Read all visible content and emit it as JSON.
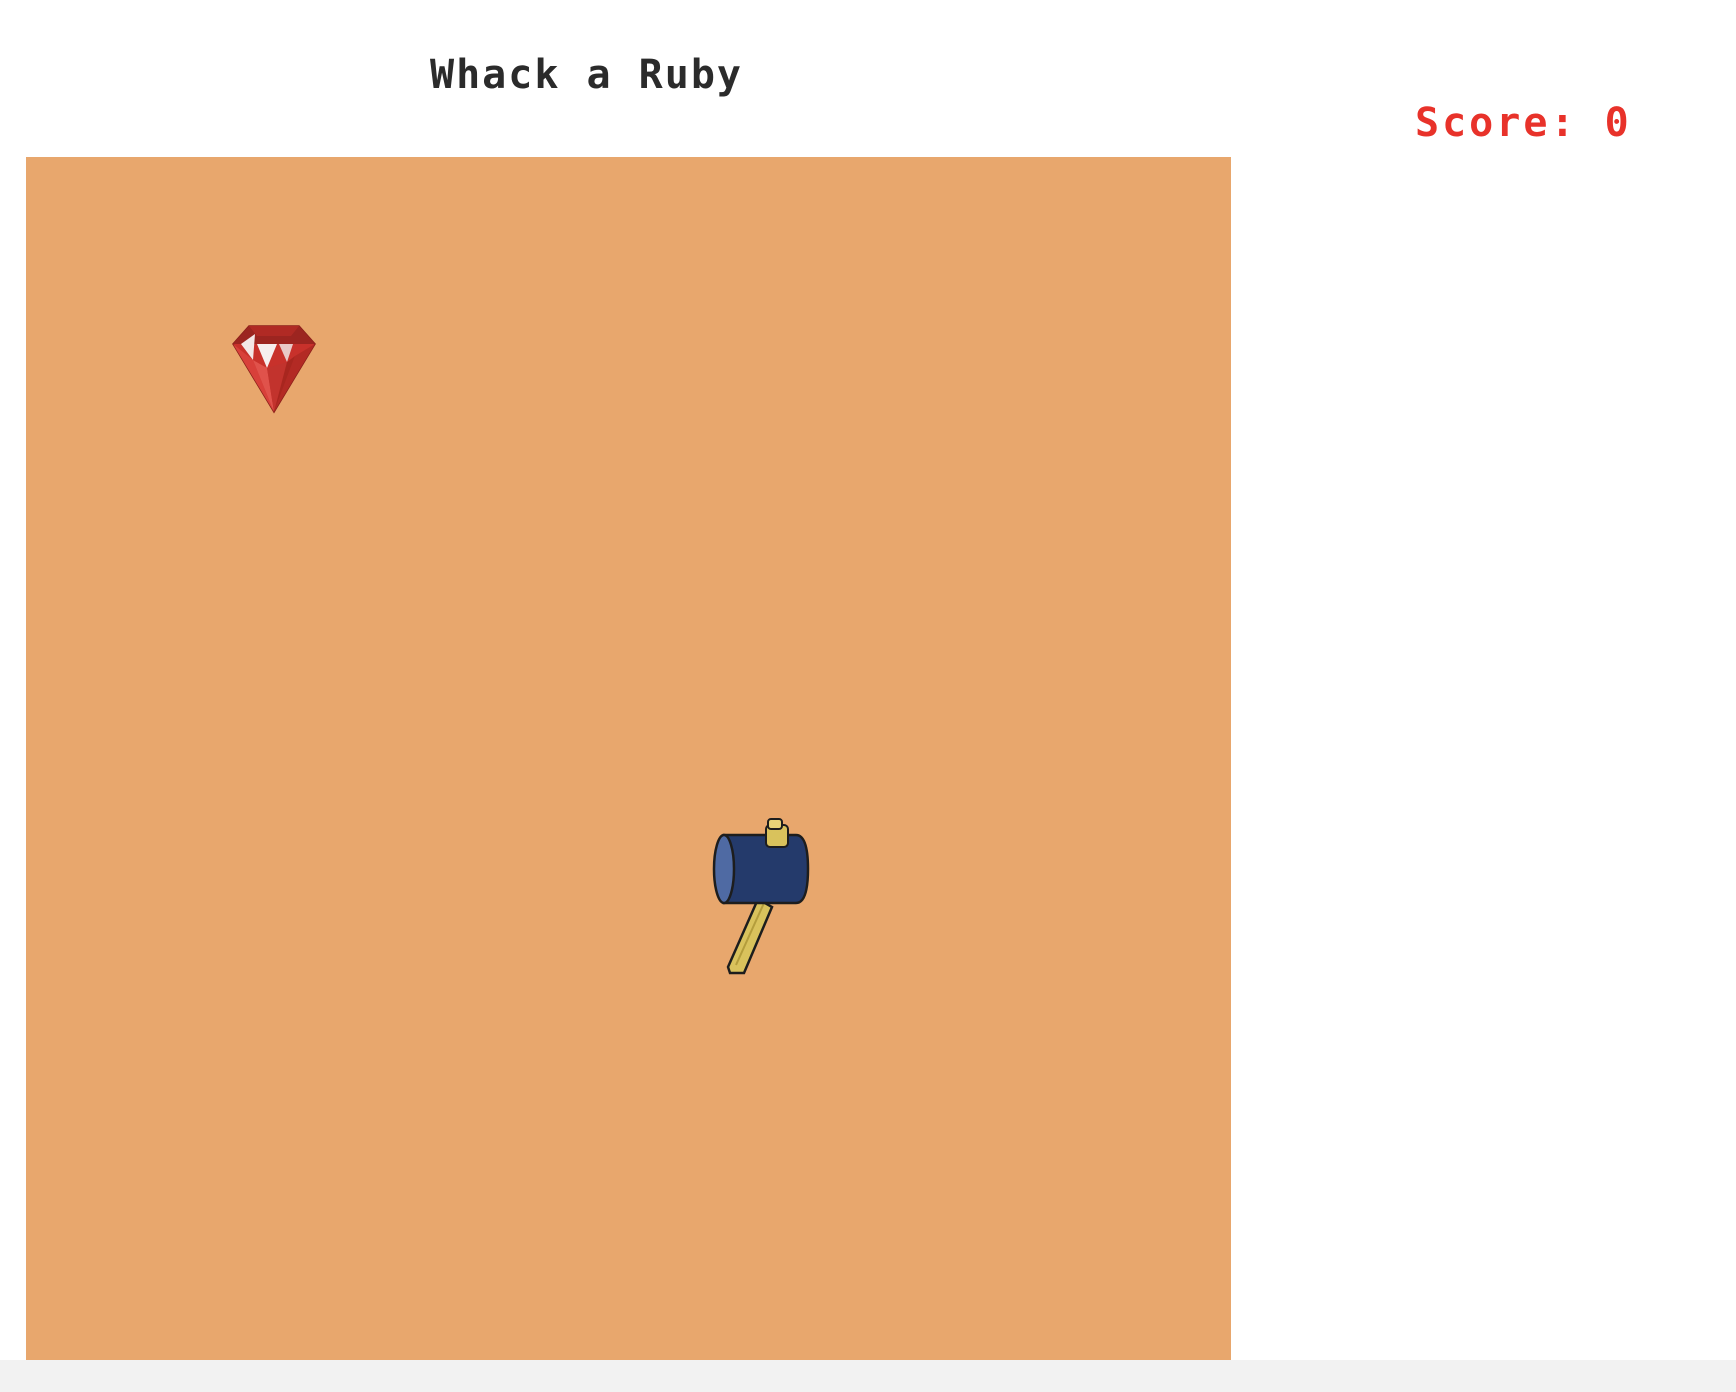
{
  "header": {
    "title": "Whack a Ruby"
  },
  "scoreboard": {
    "label": "Score:",
    "value": "0"
  },
  "colors": {
    "field": "#e8a76d",
    "score_text": "#e8322a",
    "title_text": "#2b2b2b",
    "ruby": "#c8312b",
    "hammer_head": "#243a6b",
    "hammer_handle": "#d9c25c"
  },
  "icons": {
    "ruby": "ruby-gem-icon",
    "hammer": "hammer-cursor-icon"
  }
}
